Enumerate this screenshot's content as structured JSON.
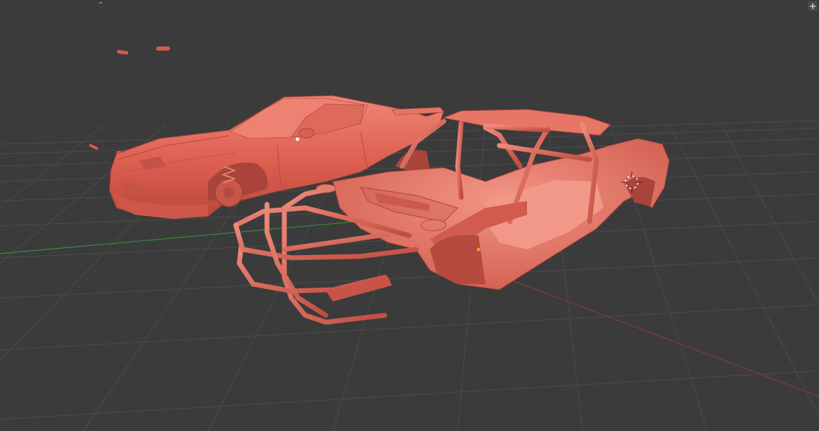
{
  "viewport": {
    "background": "#3b3b3b",
    "grid_color": "#4a4a4a",
    "x_axis_color": "#8a3a3a",
    "y_axis_color": "#3f8a3f",
    "model_color": "#e06a5a"
  },
  "corner_button": {
    "icon": "plus-icon"
  },
  "cursor": {
    "icon": "3d-cursor-icon"
  },
  "objects": [
    {
      "name": "car-body-shell",
      "icon": "car-body"
    },
    {
      "name": "roll-cage-chassis",
      "icon": "roll-cage"
    },
    {
      "name": "small-parts",
      "icon": "small-parts"
    }
  ]
}
